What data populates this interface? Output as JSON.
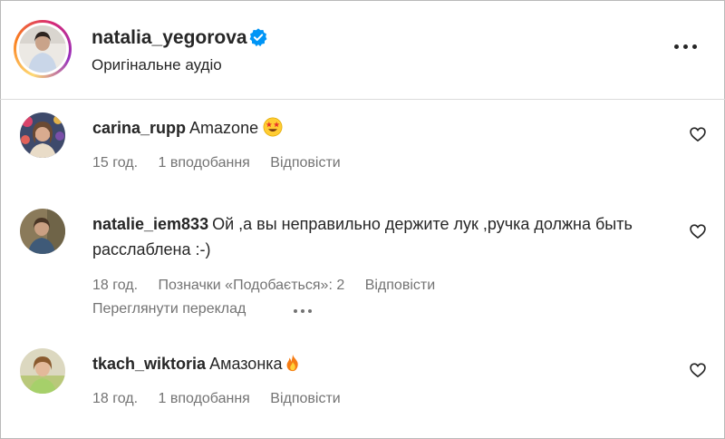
{
  "post": {
    "owner_username": "natalia_yegorova",
    "audio_label": "Оригінальне аудіо",
    "verified_icon": "verified-badge-icon",
    "more_icon": "more-options-icon"
  },
  "colors": {
    "text": "#262626",
    "secondary": "#737373",
    "verified": "#0095f6",
    "divider": "#dbdbdb"
  },
  "comments": [
    {
      "username": "carina_rupp",
      "text": "Amazone",
      "emoji": "star-struck-emoji",
      "time": "15 год.",
      "likes": "1 вподобання",
      "reply": "Відповісти"
    },
    {
      "username": "natalie_iem833",
      "text": "Ой ,а вы неправильно держите лук ,ручка должна быть расслаблена :-)",
      "time": "18 год.",
      "likes": "Позначки «Подобається»: 2",
      "reply": "Відповісти",
      "see_translation": "Переглянути переклад"
    },
    {
      "username": "tkach_wiktoria",
      "text": "Амазонка",
      "emoji": "fire-emoji",
      "time": "18 год.",
      "likes": "1 вподобання",
      "reply": "Відповісти"
    }
  ]
}
